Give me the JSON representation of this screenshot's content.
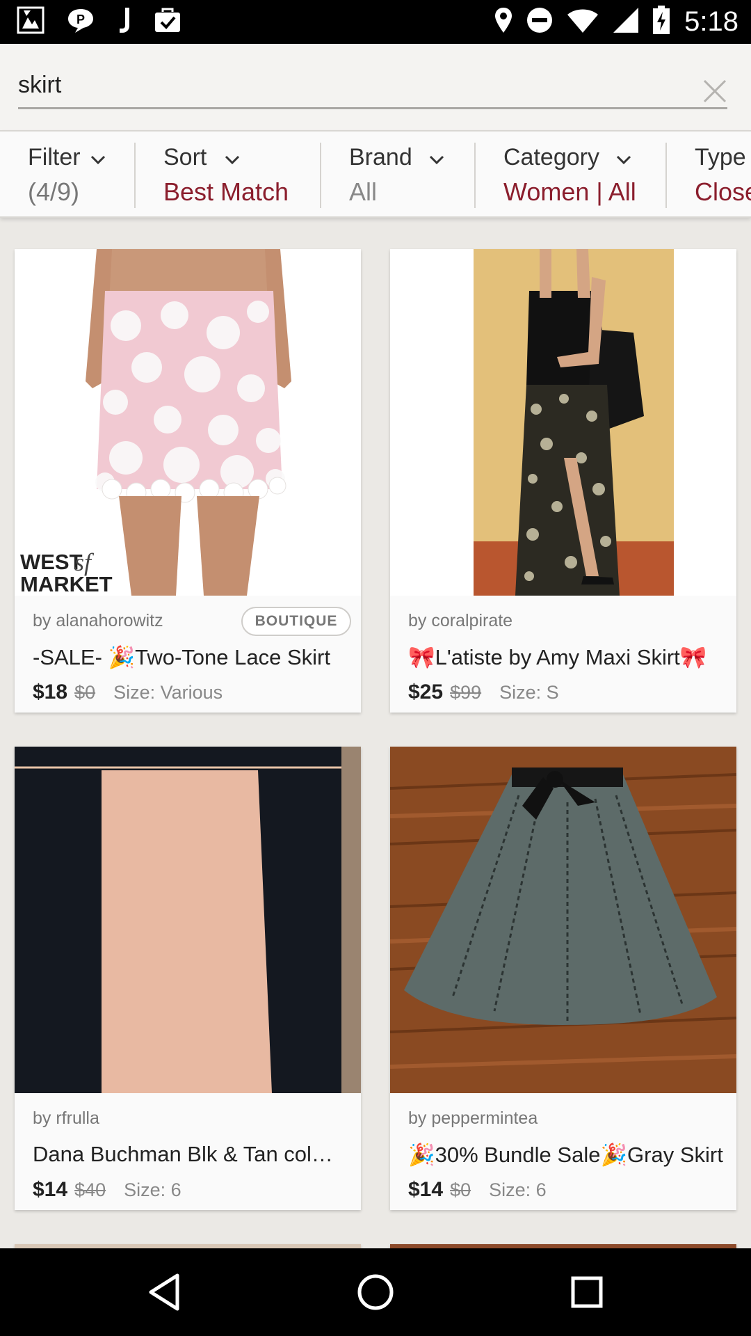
{
  "status_bar": {
    "time": "5:18",
    "left_icons": [
      "photo-notification-icon",
      "chat-notification-icon",
      "j-app-icon",
      "briefcase-check-icon"
    ],
    "right_icons": [
      "location-icon",
      "do-not-disturb-icon",
      "wifi-icon",
      "signal-icon",
      "battery-charging-icon"
    ]
  },
  "search": {
    "value": "skirt",
    "clear_icon": "close-icon"
  },
  "filters": [
    {
      "label": "Filter",
      "value": "(4/9)",
      "value_color": "#777777"
    },
    {
      "label": "Sort",
      "value": "Best Match",
      "value_color": "#8b1e2d"
    },
    {
      "label": "Brand",
      "value": "All",
      "value_color": "#888888"
    },
    {
      "label": "Category",
      "value": "Women | All",
      "value_color": "#8b1e2d"
    },
    {
      "label": "Type",
      "value": "Close",
      "value_color": "#8b1e2d"
    }
  ],
  "listings": [
    {
      "seller": "by alanahorowitz",
      "title": "-SALE- 🎉Two-Tone Lace Skirt",
      "price": "$18",
      "original_price": "$0",
      "size": "Size: Various",
      "badge": "BOUTIQUE",
      "watermark": "WEST sf MARKET"
    },
    {
      "seller": "by coralpirate",
      "title": "🎀L'atiste by Amy Maxi Skirt🎀",
      "price": "$25",
      "original_price": "$99",
      "size": "Size: S"
    },
    {
      "seller": "by rfrulla",
      "title": "Dana Buchman Blk & Tan col…",
      "price": "$14",
      "original_price": "$40",
      "size": "Size: 6"
    },
    {
      "seller": "by peppermintea",
      "title": "🎉30% Bundle Sale🎉Gray Skirt",
      "price": "$14",
      "original_price": "$0",
      "size": "Size: 6"
    }
  ],
  "nav_bar": {
    "icons": [
      "back-icon",
      "home-icon",
      "recents-icon"
    ]
  },
  "colors": {
    "accent": "#8b1e2d",
    "background": "#ebe9e5",
    "card": "#fafafa"
  }
}
